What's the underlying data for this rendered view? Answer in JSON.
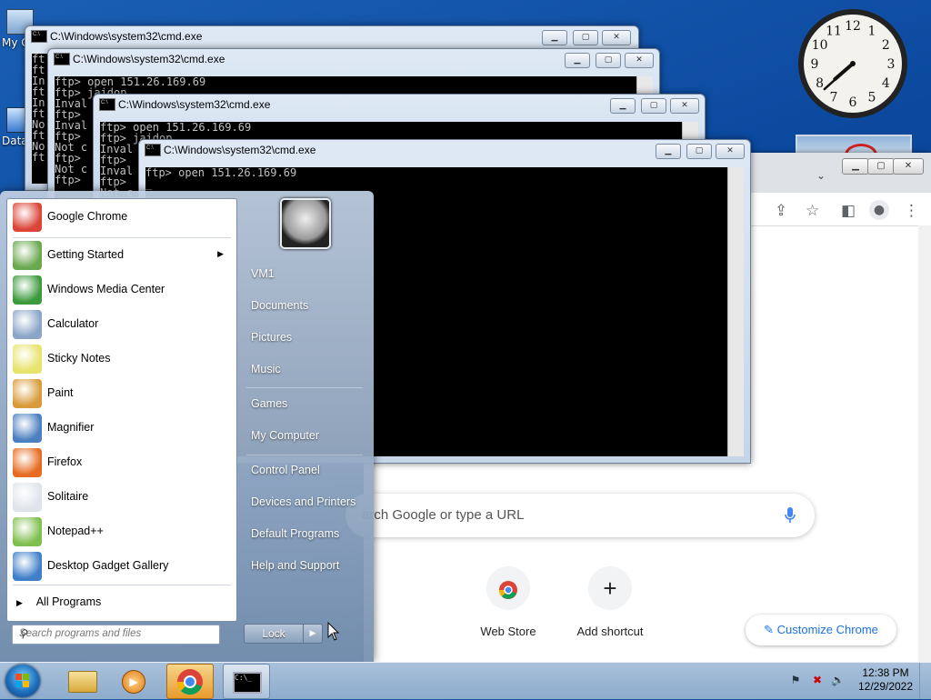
{
  "desktop": {
    "icons": [
      {
        "label": "My C",
        "icon": "computer-icon"
      },
      {
        "label": "Data",
        "icon": "data-folder-icon"
      }
    ]
  },
  "clock": {
    "hour": 7,
    "minute": 38,
    "numbers": [
      "12",
      "1",
      "2",
      "3",
      "4",
      "5",
      "6",
      "7",
      "8",
      "9",
      "10",
      "11"
    ]
  },
  "chrome": {
    "search_placeholder": "arch Google or type a URL",
    "shortcuts": [
      {
        "label": "Web Store",
        "icon": "chrome-webstore-icon"
      },
      {
        "label": "Add shortcut",
        "icon": "plus-icon"
      }
    ],
    "customize_label": "Customize Chrome",
    "toolbar_icons": [
      "share-icon",
      "star-icon",
      "sidepanel-icon",
      "profile-icon",
      "kebab-menu-icon"
    ]
  },
  "cmd_windows": [
    {
      "title": "C:\\Windows\\system32\\cmd.exe",
      "lines": [
        "ft",
        "ft",
        "In",
        "ft",
        "In",
        "ft",
        "No",
        "ft",
        "No",
        "ft"
      ]
    },
    {
      "title": "C:\\Windows\\system32\\cmd.exe",
      "lines": [
        "ftp> open 151.26.169.69",
        "ftp> jaidop",
        "Inval",
        "ftp>",
        "Inval",
        "ftp>",
        "Not c",
        "ftp>",
        "Not c",
        "ftp>"
      ]
    },
    {
      "title": "C:\\Windows\\system32\\cmd.exe",
      "lines": [
        "ftp> open 151.26.169.69",
        "ftp> jaidop",
        "Inval",
        "ftp>",
        "Inval",
        "ftp>",
        "Not c"
      ]
    },
    {
      "title": "C:\\Windows\\system32\\cmd.exe",
      "lines": [
        "ftp> open 151.26.169.69",
        "_"
      ]
    }
  ],
  "start_menu": {
    "programs": [
      {
        "label": "Google Chrome",
        "icon": "chrome-icon",
        "has_submenu": false,
        "color": "#db4437"
      },
      {
        "label": "Getting Started",
        "icon": "getting-started-icon",
        "has_submenu": true,
        "color": "#6aa84f"
      },
      {
        "label": "Windows Media Center",
        "icon": "media-center-icon",
        "has_submenu": false,
        "color": "#3c9a3c"
      },
      {
        "label": "Calculator",
        "icon": "calculator-icon",
        "has_submenu": false,
        "color": "#8aa5c8"
      },
      {
        "label": "Sticky Notes",
        "icon": "sticky-notes-icon",
        "has_submenu": false,
        "color": "#e8e36a"
      },
      {
        "label": "Paint",
        "icon": "paint-icon",
        "has_submenu": false,
        "color": "#d99b3a"
      },
      {
        "label": "Magnifier",
        "icon": "magnifier-icon",
        "has_submenu": false,
        "color": "#4a7fc0"
      },
      {
        "label": "Firefox",
        "icon": "firefox-icon",
        "has_submenu": false,
        "color": "#e66a1f"
      },
      {
        "label": "Solitaire",
        "icon": "solitaire-icon",
        "has_submenu": false,
        "color": "#dfe4ea"
      },
      {
        "label": "Notepad++",
        "icon": "notepad-plus-plus-icon",
        "has_submenu": false,
        "color": "#7fbf4f"
      },
      {
        "label": "Desktop Gadget Gallery",
        "icon": "gadget-gallery-icon",
        "has_submenu": false,
        "color": "#3f7fc8"
      }
    ],
    "all_programs": "All Programs",
    "search_placeholder": "Search programs and files",
    "right_items": [
      "VM1",
      "Documents",
      "Pictures",
      "Music",
      "Games",
      "My Computer",
      "Control Panel",
      "Devices and Printers",
      "Default Programs",
      "Help and Support"
    ],
    "lock_label": "Lock"
  },
  "taskbar": {
    "buttons": [
      {
        "name": "explorer",
        "icon": "folder-icon",
        "state": "normal"
      },
      {
        "name": "media-player",
        "icon": "media-player-icon",
        "state": "normal"
      },
      {
        "name": "chrome",
        "icon": "chrome-icon",
        "state": "active"
      },
      {
        "name": "cmd",
        "icon": "cmd-icon",
        "state": "open"
      }
    ],
    "time": "12:38 PM",
    "date": "12/29/2022"
  }
}
